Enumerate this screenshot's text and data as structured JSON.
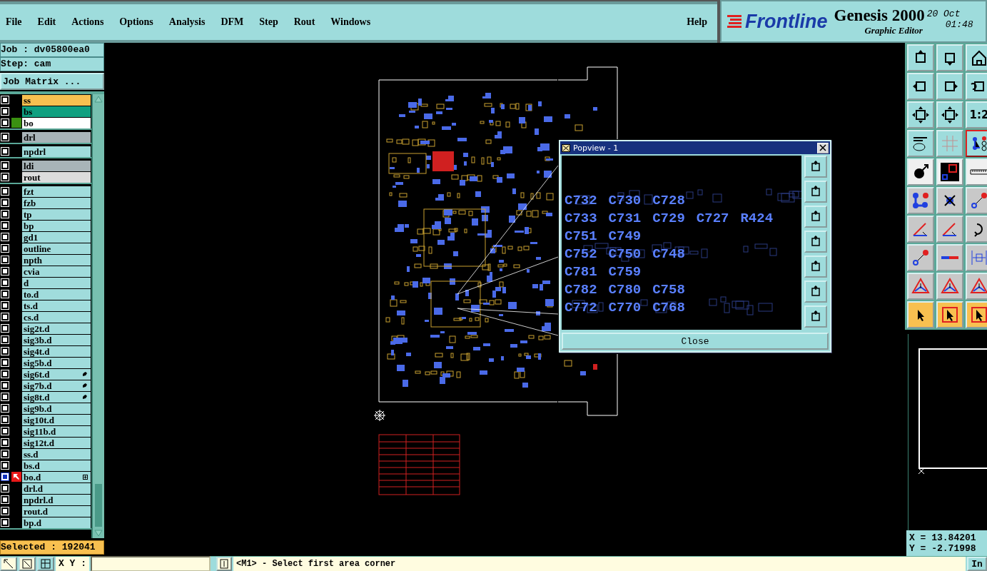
{
  "menu": [
    {
      "label": "File"
    },
    {
      "label": "Edit"
    },
    {
      "label": "Actions"
    },
    {
      "label": "Options"
    },
    {
      "label": "Analysis"
    },
    {
      "label": "DFM"
    },
    {
      "label": "Step"
    },
    {
      "label": "Rout"
    },
    {
      "label": "Windows"
    }
  ],
  "help": "Help",
  "brand": {
    "logo": "Frontline",
    "product": "Genesis 2000",
    "subtitle": "Graphic Editor",
    "date": "20 Oct",
    "time": "01:48"
  },
  "job": "Job : dv05800ea0",
  "step": "Step: cam",
  "job_matrix_button": "Job Matrix ...",
  "layer_groups": [
    [
      {
        "name": "ss",
        "color": "#f8c050",
        "affected": false,
        "work": false,
        "flag": false,
        "selected": false
      },
      {
        "name": "bs",
        "color": "#10a080",
        "affected": false,
        "work": false,
        "flag": false,
        "selected": false
      },
      {
        "name": "bo",
        "color": "#ffffff",
        "affected": true,
        "work": false,
        "flag": false,
        "selected": false
      }
    ],
    [
      {
        "name": "drl",
        "color": "#a8b4b8",
        "affected": false,
        "work": false,
        "flag": false,
        "selected": false
      }
    ],
    [
      {
        "name": "npdrl",
        "color": "#a0dcdc",
        "affected": false,
        "work": false,
        "flag": false,
        "selected": false
      }
    ],
    [
      {
        "name": "ldi",
        "color": "#a8b4b8",
        "affected": false,
        "work": false,
        "flag": false,
        "selected": false
      },
      {
        "name": "rout",
        "color": "#dcdcdc",
        "affected": false,
        "work": false,
        "flag": false,
        "selected": false
      }
    ],
    [
      {
        "name": "fzt",
        "color": "#a0dcdc",
        "affected": false,
        "work": false,
        "flag": false,
        "selected": false
      },
      {
        "name": "fzb",
        "color": "#a0dcdc",
        "affected": false,
        "work": false,
        "flag": false,
        "selected": false
      },
      {
        "name": "tp",
        "color": "#a0dcdc",
        "affected": false,
        "work": false,
        "flag": false,
        "selected": false
      },
      {
        "name": "bp",
        "color": "#a0dcdc",
        "affected": false,
        "work": false,
        "flag": false,
        "selected": false
      },
      {
        "name": "gd1",
        "color": "#a0dcdc",
        "affected": false,
        "work": false,
        "flag": false,
        "selected": false
      },
      {
        "name": "outline",
        "color": "#a0dcdc",
        "affected": false,
        "work": false,
        "flag": false,
        "selected": false
      },
      {
        "name": "npth",
        "color": "#a0dcdc",
        "affected": false,
        "work": false,
        "flag": false,
        "selected": false
      },
      {
        "name": "cvia",
        "color": "#a0dcdc",
        "affected": false,
        "work": false,
        "flag": false,
        "selected": false
      },
      {
        "name": "d",
        "color": "#a0dcdc",
        "affected": false,
        "work": false,
        "flag": false,
        "selected": false
      },
      {
        "name": "to.d",
        "color": "#a0dcdc",
        "affected": false,
        "work": false,
        "flag": false,
        "selected": false
      },
      {
        "name": "ts.d",
        "color": "#a0dcdc",
        "affected": false,
        "work": false,
        "flag": false,
        "selected": false
      },
      {
        "name": "cs.d",
        "color": "#a0dcdc",
        "affected": false,
        "work": false,
        "flag": false,
        "selected": false
      },
      {
        "name": "sig2t.d",
        "color": "#a0dcdc",
        "affected": false,
        "work": false,
        "flag": false,
        "selected": false
      },
      {
        "name": "sig3b.d",
        "color": "#a0dcdc",
        "affected": false,
        "work": false,
        "flag": false,
        "selected": false
      },
      {
        "name": "sig4t.d",
        "color": "#a0dcdc",
        "affected": false,
        "work": false,
        "flag": false,
        "selected": false
      },
      {
        "name": "sig5b.d",
        "color": "#a0dcdc",
        "affected": false,
        "work": false,
        "flag": false,
        "selected": false
      },
      {
        "name": "sig6t.d",
        "color": "#a0dcdc",
        "affected": false,
        "work": false,
        "flag": true,
        "selected": false
      },
      {
        "name": "sig7b.d",
        "color": "#a0dcdc",
        "affected": false,
        "work": false,
        "flag": true,
        "selected": false
      },
      {
        "name": "sig8t.d",
        "color": "#a0dcdc",
        "affected": false,
        "work": false,
        "flag": true,
        "selected": false
      },
      {
        "name": "sig9b.d",
        "color": "#a0dcdc",
        "affected": false,
        "work": false,
        "flag": false,
        "selected": false
      },
      {
        "name": "sig10t.d",
        "color": "#a0dcdc",
        "affected": false,
        "work": false,
        "flag": false,
        "selected": false
      },
      {
        "name": "sig11b.d",
        "color": "#a0dcdc",
        "affected": false,
        "work": false,
        "flag": false,
        "selected": false
      },
      {
        "name": "sig12t.d",
        "color": "#a0dcdc",
        "affected": false,
        "work": false,
        "flag": false,
        "selected": false
      },
      {
        "name": "ss.d",
        "color": "#a0dcdc",
        "affected": false,
        "work": false,
        "flag": false,
        "selected": false
      },
      {
        "name": "bs.d",
        "color": "#a0dcdc",
        "affected": false,
        "work": false,
        "flag": false,
        "selected": false
      },
      {
        "name": "bo.d",
        "color": "#a0dcdc",
        "affected": false,
        "work": true,
        "flag": false,
        "selected": true
      },
      {
        "name": "drl.d",
        "color": "#a0dcdc",
        "affected": false,
        "work": false,
        "flag": false,
        "selected": false
      },
      {
        "name": "npdrl.d",
        "color": "#a0dcdc",
        "affected": false,
        "work": false,
        "flag": false,
        "selected": false
      },
      {
        "name": "rout.d",
        "color": "#a0dcdc",
        "affected": false,
        "work": false,
        "flag": false,
        "selected": false
      },
      {
        "name": "bp.d",
        "color": "#a0dcdc",
        "affected": false,
        "work": false,
        "flag": false,
        "selected": false
      }
    ]
  ],
  "selected_count": "Selected : 192041",
  "popview": {
    "title": "Popview - 1",
    "labels": [
      [
        "C732",
        "C730",
        "C728"
      ],
      [
        "C733",
        "C731",
        "C729",
        "C727",
        "R424"
      ],
      [
        "C751",
        "C749"
      ],
      [
        "C752",
        "C750",
        "C748"
      ],
      [
        "C781",
        "C759"
      ],
      [
        "C782",
        "C780",
        "C758"
      ],
      [
        "C772",
        "C770",
        "C768"
      ]
    ],
    "close_button": "Close"
  },
  "zoom_ratio_button": "1:2",
  "coordinates": {
    "x": "X = 13.84201",
    "y": "Y = -2.71998"
  },
  "bottom": {
    "xy_label": "X Y :",
    "prompt": "<M1> - Select first area corner",
    "in_button": "In"
  }
}
